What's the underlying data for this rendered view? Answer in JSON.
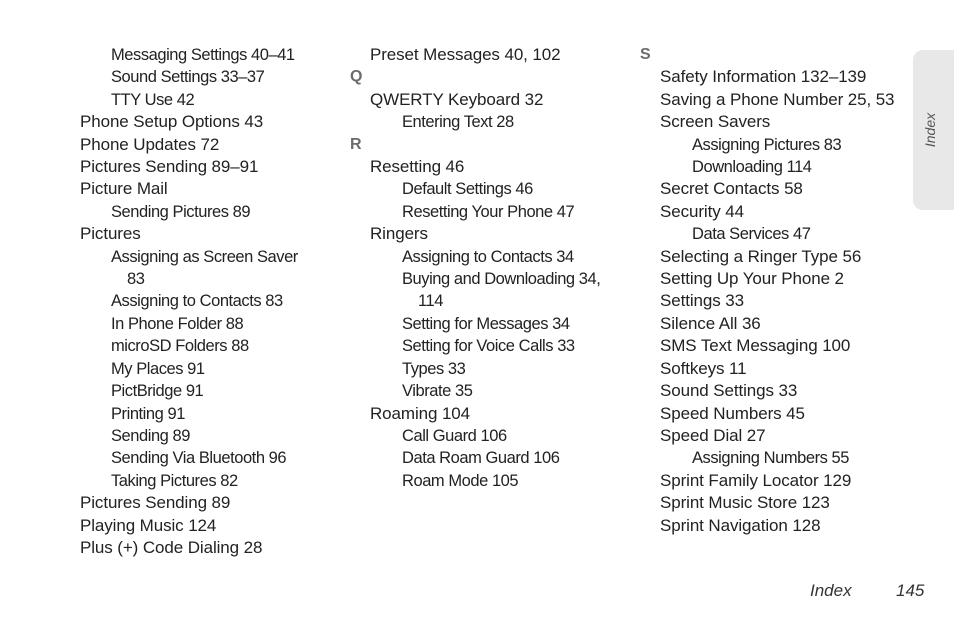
{
  "tab": {
    "label": "Index"
  },
  "footer": {
    "section": "Index",
    "page_number": "145"
  },
  "columns": [
    {
      "entries": [
        {
          "level": 2,
          "text": "Messaging Settings 40–41"
        },
        {
          "level": 2,
          "text": "Sound Settings 33–37"
        },
        {
          "level": 2,
          "text": "TTY Use 42"
        },
        {
          "level": 1,
          "text": "Phone Setup Options 43"
        },
        {
          "level": 1,
          "text": "Phone Updates 72"
        },
        {
          "level": 1,
          "text": "Pictures Sending 89–91"
        },
        {
          "level": 1,
          "text": "Picture Mail"
        },
        {
          "level": 2,
          "text": "Sending Pictures 89"
        },
        {
          "level": 1,
          "text": "Pictures"
        },
        {
          "level": 2,
          "text": "Assigning as Screen Saver",
          "cont": "83"
        },
        {
          "level": 2,
          "text": "Assigning to Contacts 83"
        },
        {
          "level": 2,
          "text": "In Phone Folder 88"
        },
        {
          "level": 2,
          "text": "microSD Folders 88"
        },
        {
          "level": 2,
          "text": "My Places 91"
        },
        {
          "level": 2,
          "text": "PictBridge 91"
        },
        {
          "level": 2,
          "text": "Printing 91"
        },
        {
          "level": 2,
          "text": "Sending 89"
        },
        {
          "level": 2,
          "text": "Sending Via Bluetooth 96"
        },
        {
          "level": 2,
          "text": "Taking Pictures 82"
        },
        {
          "level": 1,
          "text": "Pictures Sending 89"
        },
        {
          "level": 1,
          "text": "Playing Music 124"
        },
        {
          "level": 1,
          "text": "Plus (+) Code Dialing 28"
        }
      ]
    },
    {
      "entries": [
        {
          "level": 1,
          "text": "Preset Messages 40, 102"
        },
        {
          "level": 0,
          "text": "Q"
        },
        {
          "level": 1,
          "text": "QWERTY Keyboard 32"
        },
        {
          "level": 2,
          "text": "Entering Text 28"
        },
        {
          "level": 0,
          "text": "R"
        },
        {
          "level": 1,
          "text": "Resetting 46"
        },
        {
          "level": 2,
          "text": "Default Settings 46"
        },
        {
          "level": 2,
          "text": "Resetting Your Phone 47"
        },
        {
          "level": 1,
          "text": "Ringers"
        },
        {
          "level": 2,
          "text": "Assigning to Contacts 34"
        },
        {
          "level": 2,
          "text": "Buying and Downloading 34,",
          "cont": "114"
        },
        {
          "level": 2,
          "text": "Setting for Messages 34"
        },
        {
          "level": 2,
          "text": "Setting for Voice Calls 33"
        },
        {
          "level": 2,
          "text": "Types 33"
        },
        {
          "level": 2,
          "text": "Vibrate 35"
        },
        {
          "level": 1,
          "text": "Roaming 104"
        },
        {
          "level": 2,
          "text": "Call Guard 106"
        },
        {
          "level": 2,
          "text": "Data Roam Guard 106"
        },
        {
          "level": 2,
          "text": "Roam Mode 105"
        }
      ]
    },
    {
      "entries": [
        {
          "level": 0,
          "text": "S"
        },
        {
          "level": 1,
          "text": "Safety Information 132–139"
        },
        {
          "level": 1,
          "text": "Saving a Phone Number 25, 53"
        },
        {
          "level": 1,
          "text": "Screen Savers"
        },
        {
          "level": 2,
          "text": "Assigning Pictures 83"
        },
        {
          "level": 2,
          "text": "Downloading 114"
        },
        {
          "level": 1,
          "text": "Secret Contacts 58"
        },
        {
          "level": 1,
          "text": "Security 44"
        },
        {
          "level": 2,
          "text": "Data Services 47"
        },
        {
          "level": 1,
          "text": "Selecting a Ringer Type 56"
        },
        {
          "level": 1,
          "text": "Setting Up Your Phone 2"
        },
        {
          "level": 1,
          "text": "Settings 33"
        },
        {
          "level": 1,
          "text": "Silence All 36"
        },
        {
          "level": 1,
          "text": "SMS Text Messaging 100"
        },
        {
          "level": 1,
          "text": "Softkeys 11"
        },
        {
          "level": 1,
          "text": "Sound Settings 33"
        },
        {
          "level": 1,
          "text": "Speed Numbers 45"
        },
        {
          "level": 1,
          "text": "Speed Dial 27"
        },
        {
          "level": 2,
          "text": "Assigning Numbers 55"
        },
        {
          "level": 1,
          "text": "Sprint Family Locator 129"
        },
        {
          "level": 1,
          "text": "Sprint Music Store 123"
        },
        {
          "level": 1,
          "text": "Sprint Navigation 128"
        }
      ]
    }
  ]
}
